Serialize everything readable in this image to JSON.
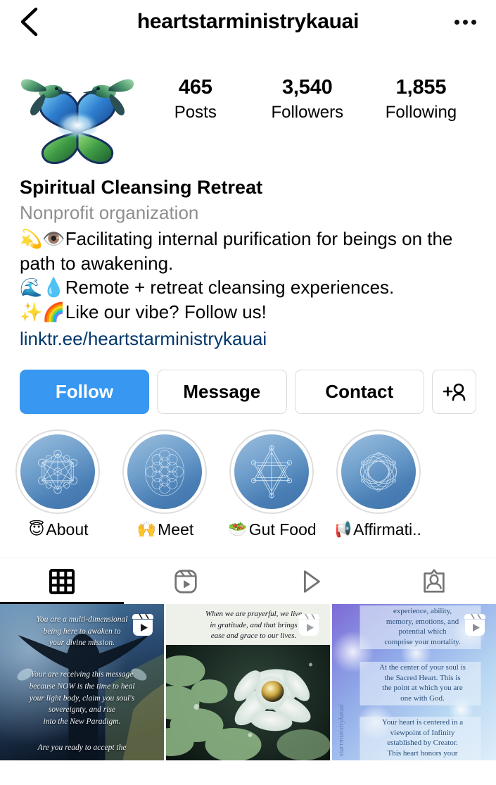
{
  "header": {
    "title": "heartstarministrykauai",
    "back_icon": "chevron-left-icon",
    "menu_icon": "more-options-icon"
  },
  "profile": {
    "avatar_alt": "heart-star-hummingbird-logo",
    "stats": [
      {
        "value": "465",
        "label": "Posts"
      },
      {
        "value": "3,540",
        "label": "Followers"
      },
      {
        "value": "1,855",
        "label": "Following"
      }
    ],
    "display_name": "Spiritual Cleansing Retreat",
    "category": "Nonprofit organization",
    "bio_lines": [
      {
        "emoji": "💫👁️",
        "text": "Facilitating internal purification for beings on the path to awakening."
      },
      {
        "emoji": "🌊💧",
        "text": "Remote + retreat cleansing experiences."
      },
      {
        "emoji": "✨🌈",
        "text": "Like our vibe? Follow us!"
      }
    ],
    "link": "linktr.ee/heartstarministrykauai",
    "link_color": "#00376b"
  },
  "actions": {
    "follow_label": "Follow",
    "follow_color": "#3897f0",
    "message_label": "Message",
    "contact_label": "Contact",
    "add_person_icon": "add-person-icon"
  },
  "highlights": [
    {
      "emoji": "😇",
      "label": "About",
      "cover": "metatrons-cube"
    },
    {
      "emoji": "🙌",
      "label": "Meet",
      "cover": "flower-of-life"
    },
    {
      "emoji": "🥗",
      "label": "Gut Food",
      "cover": "merkaba-star"
    },
    {
      "emoji": "📢",
      "label": "Affirmati...",
      "cover": "seed-of-life"
    }
  ],
  "tabs": [
    {
      "name": "grid",
      "icon": "grid-icon",
      "active": true
    },
    {
      "name": "reels",
      "icon": "reels-icon",
      "active": false
    },
    {
      "name": "igtv",
      "icon": "play-icon",
      "active": false
    },
    {
      "name": "tagged",
      "icon": "tagged-person-icon",
      "active": false
    }
  ],
  "posts": [
    {
      "type": "reel",
      "theme": "winged-figure-sky",
      "lines": [
        "You are a multi-dimensional",
        "being here to awaken to",
        "your divine mission.",
        "",
        "Your are receiving this message",
        "because NOW is the time to heal",
        "your light body, claim you soul's",
        "sovereignty, and rise",
        "into the New Paradigm.",
        "",
        "Are you ready to accept the"
      ]
    },
    {
      "type": "reel",
      "theme": "white-lotus-lilypads",
      "lines": [
        "When we are prayerful, we live",
        "in gratitude, and that brings",
        "ease and grace to our lives."
      ]
    },
    {
      "type": "reel",
      "theme": "blue-violet-light",
      "watermark": "starrministrykauai",
      "lines": [
        "experience, ability,",
        "memory, emotions, and",
        "potential which",
        "comprise your mortality.",
        "At the center of your soul is",
        "the Sacred Heart. This is",
        "the point at which you are",
        "one with God.",
        "Your heart is centered in a",
        "viewpoint of Infinity",
        "established by Creator.",
        "This heart honors your"
      ]
    }
  ]
}
